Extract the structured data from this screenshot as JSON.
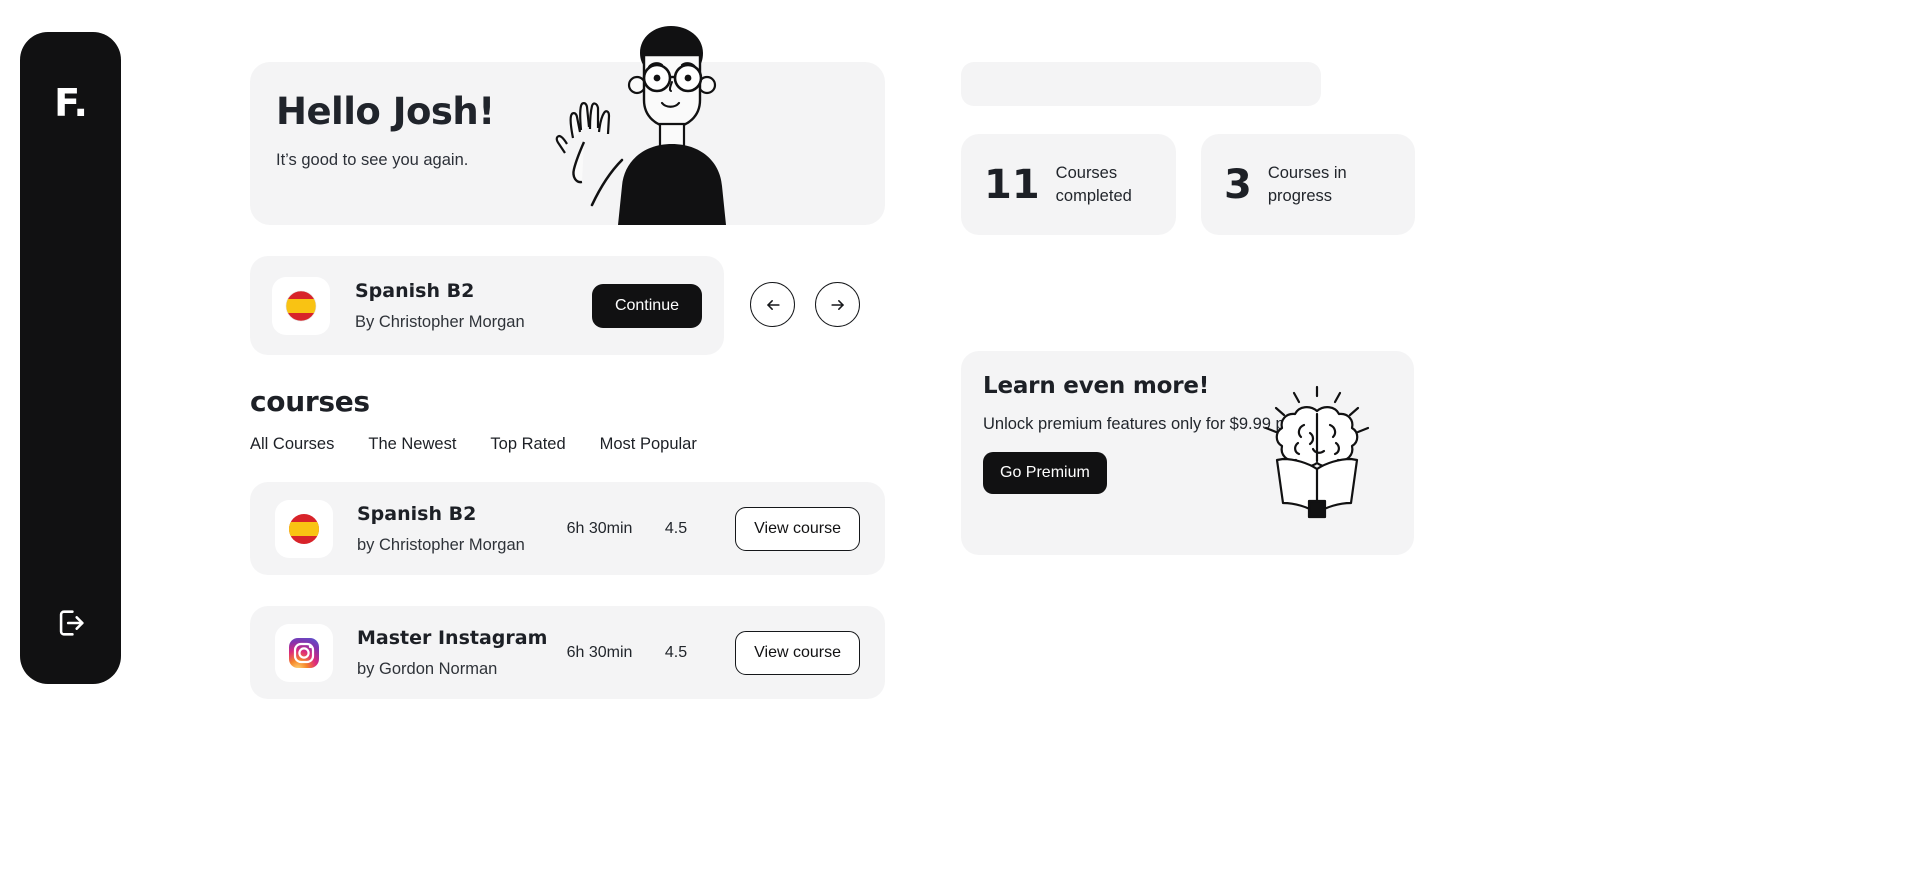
{
  "sidebar": {
    "logo_text": "F.",
    "logout_icon": "logout-icon"
  },
  "hero": {
    "title": "Hello Josh!",
    "subtitle": "It’s good to see you again.",
    "illustration": "waving-person-illustration"
  },
  "continue_card": {
    "course_title": "Spanish B2",
    "author": "By Christopher Morgan",
    "button_label": "Continue",
    "icon": "spain-flag-icon",
    "prev_icon": "arrow-left-icon",
    "next_icon": "arrow-right-icon"
  },
  "courses_section": {
    "heading": "courses",
    "tabs": [
      {
        "label": "All Courses"
      },
      {
        "label": "The Newest"
      },
      {
        "label": "Top Rated"
      },
      {
        "label": "Most Popular"
      }
    ],
    "rows": [
      {
        "title": "Spanish B2",
        "author": "by Christopher Morgan",
        "duration": "6h 30min",
        "rating": "4.5",
        "button_label": "View course",
        "icon": "spain-flag-icon"
      },
      {
        "title": "Master Instagram",
        "author": "by Gordon Norman",
        "duration": "6h 30min",
        "rating": "4.5",
        "button_label": "View course",
        "icon": "instagram-icon"
      }
    ]
  },
  "search": {
    "value": "",
    "placeholder": ""
  },
  "stats": [
    {
      "value": "11",
      "label": "Courses completed"
    },
    {
      "value": "3",
      "label": "Courses in progress"
    }
  ],
  "premium": {
    "title": "Learn even more!",
    "subtitle": "Unlock premium features only for $9.99 per month.",
    "button_label": "Go Premium",
    "illustration": "brain-on-book-icon"
  },
  "colors": {
    "ink": "#111112",
    "card_bg": "#f4f4f5",
    "page_bg": "#ffffff",
    "flag_red": "#d8232a",
    "flag_yellow": "#f9c313"
  }
}
